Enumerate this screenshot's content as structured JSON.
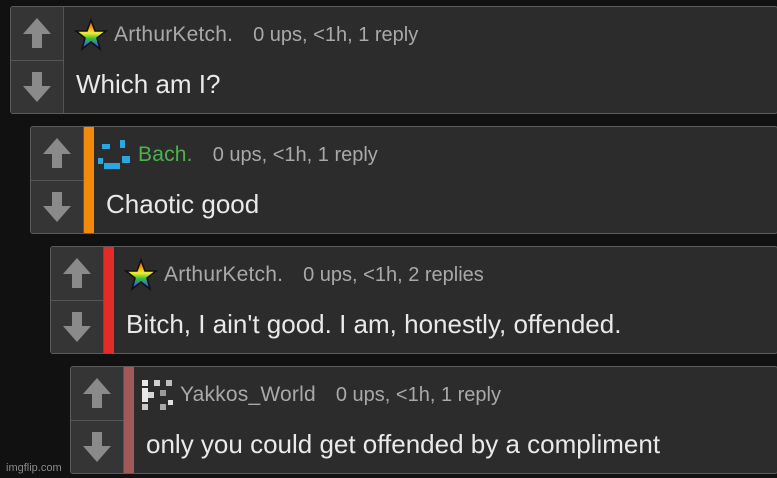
{
  "comments": [
    {
      "username": "ArthurKetch.",
      "meta": "0 ups, <1h, 1 reply",
      "text": "Which am I?",
      "avatar_icon": "rainbow-star-icon",
      "stripe_color": null
    },
    {
      "username": "Bach.",
      "meta": "0 ups, <1h, 1 reply",
      "text": "Chaotic good",
      "avatar_icon": "pixel-smiley-icon",
      "stripe_color": "#f28a0c"
    },
    {
      "username": "ArthurKetch.",
      "meta": "0 ups, <1h, 2 replies",
      "text": "Bitch, I ain't good. I am, honestly, offended.",
      "avatar_icon": "rainbow-star-icon",
      "stripe_color": "#e52a2a"
    },
    {
      "username": "Yakkos_World",
      "meta": "0 ups, <1h, 1 reply",
      "text": "only you could get offended by a compliment",
      "avatar_icon": "pixel-pattern-icon",
      "stripe_color": "#a05858"
    }
  ],
  "watermark": "imgflip.com",
  "colors": {
    "background": "#111111",
    "panel": "#2c2c2c",
    "username": "#a9a9a9",
    "username_green": "#4cb34c",
    "text": "#e9e9e9"
  }
}
